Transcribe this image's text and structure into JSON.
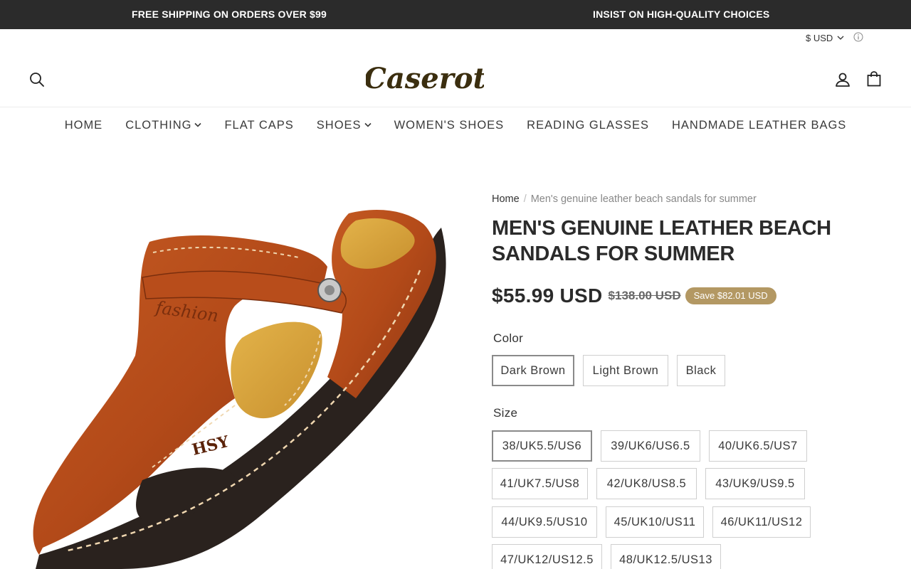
{
  "announcement": {
    "left": "FREE SHIPPING ON ORDERS OVER $99",
    "right": "INSIST ON HIGH-QUALITY CHOICES"
  },
  "header": {
    "currency": "$ USD",
    "logo": "Caserot",
    "icons": [
      "search-icon",
      "account-icon",
      "cart-icon"
    ]
  },
  "nav": [
    {
      "label": "HOME",
      "dropdown": false
    },
    {
      "label": "CLOTHING",
      "dropdown": true
    },
    {
      "label": "FLAT CAPS",
      "dropdown": false
    },
    {
      "label": "SHOES",
      "dropdown": true
    },
    {
      "label": "WOMEN'S SHOES",
      "dropdown": false
    },
    {
      "label": "READING GLASSES",
      "dropdown": false
    },
    {
      "label": "HANDMADE LEATHER BAGS",
      "dropdown": false
    }
  ],
  "breadcrumb": {
    "home": "Home",
    "separator": "/",
    "current": "Men's genuine leather beach sandals for summer"
  },
  "product": {
    "title": "MEN'S GENUINE LEATHER BEACH SANDALS FOR SUMMER",
    "price": "$55.99 USD",
    "compare_price": "$138.00 USD",
    "save_badge": "Save $82.01 USD",
    "sandal_stamp_1": "fashion",
    "sandal_stamp_2": "HSY"
  },
  "color": {
    "label": "Color",
    "options": [
      "Dark Brown",
      "Light Brown",
      "Black"
    ],
    "selected": "Dark Brown"
  },
  "size": {
    "label": "Size",
    "options": [
      "38/UK5.5/US6",
      "39/UK6/US6.5",
      "40/UK6.5/US7",
      "41/UK7.5/US8",
      "42/UK8/US8.5",
      "43/UK9/US9.5",
      "44/UK9.5/US10",
      "45/UK10/US11",
      "46/UK11/US12",
      "47/UK12/US12.5",
      "48/UK12.5/US13"
    ],
    "selected": "38/UK5.5/US6"
  },
  "colors": {
    "announcement_bg": "#2b2b2b",
    "save_badge_bg": "#b39863",
    "logo": "#3b2e0f"
  }
}
